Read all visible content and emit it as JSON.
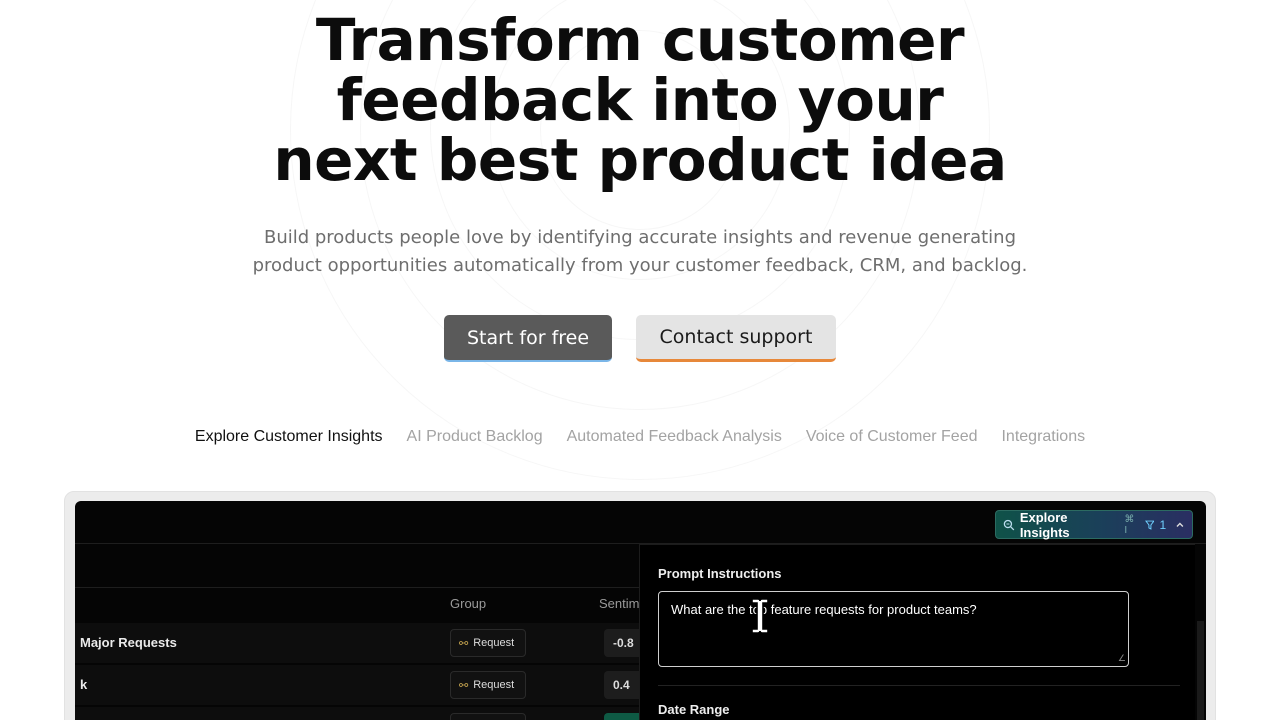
{
  "hero": {
    "title_lines": [
      "Transform customer",
      "feedback into your",
      "next best product idea"
    ],
    "subtitle_lines": [
      "Build products people love by identifying accurate insights and revenue generating",
      "product opportunities automatically from your customer feedback, CRM, and backlog."
    ],
    "primary_cta": "Start for free",
    "secondary_cta": "Contact support"
  },
  "tabs": [
    {
      "label": "Explore Customer Insights",
      "active": true
    },
    {
      "label": "AI Product Backlog",
      "active": false
    },
    {
      "label": "Automated Feedback Analysis",
      "active": false
    },
    {
      "label": "Voice of Customer Feed",
      "active": false
    },
    {
      "label": "Integrations",
      "active": false
    }
  ],
  "app": {
    "explore_button": {
      "label": "Explore Insights",
      "shortcut": "⌘ I",
      "filter_count": "1",
      "icon": "search-icon"
    },
    "table": {
      "headers": {
        "group": "Group",
        "sentiment": "Sentim"
      },
      "rows": [
        {
          "label": "Major Requests",
          "group": "Request",
          "score": "-0.8"
        },
        {
          "label": "k",
          "group": "Request",
          "score": "0.4"
        }
      ]
    },
    "panel": {
      "title": "Prompt Instructions",
      "prompt_value": "What are the top feature requests for product teams?",
      "date_range_title": "Date Range"
    }
  },
  "colors": {
    "primary_cta_bg": "#5a5a5a",
    "secondary_cta_underline": "#e7883a",
    "explore_gradient_start": "#0f5248",
    "explore_gradient_end": "#2a2e62"
  }
}
